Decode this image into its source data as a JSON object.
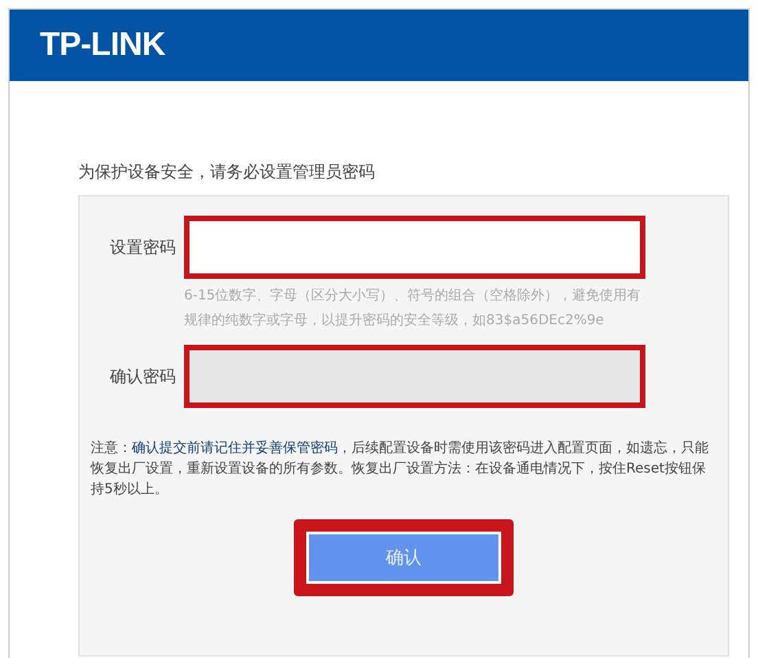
{
  "header": {
    "logo": "TP-LINK"
  },
  "heading": "为保护设备安全，请务必设置管理员密码",
  "fields": [
    {
      "label": "设置密码",
      "highlighted": true,
      "disabled": false,
      "hint": "6-15位数字、字母（区分大小写）、符号的组合（空格除外），避免使用有规律的纯数字或字母，以提升密码的安全等级，如83$a56DEc2%9e"
    },
    {
      "label": "确认密码",
      "highlighted": true,
      "disabled": true
    }
  ],
  "note": "注意：**确认提交前请记住并妥善保管密码**，后续配置设备时需使用该密码进入配置页面，如遗忘，只能恢复出厂设置，重新设置设备的所有参数。恢复出厂设置方法：在设备通电情况下，按住Reset按钮保持5秒以上。",
  "button": {
    "label": "确认",
    "highlighted": true
  }
}
